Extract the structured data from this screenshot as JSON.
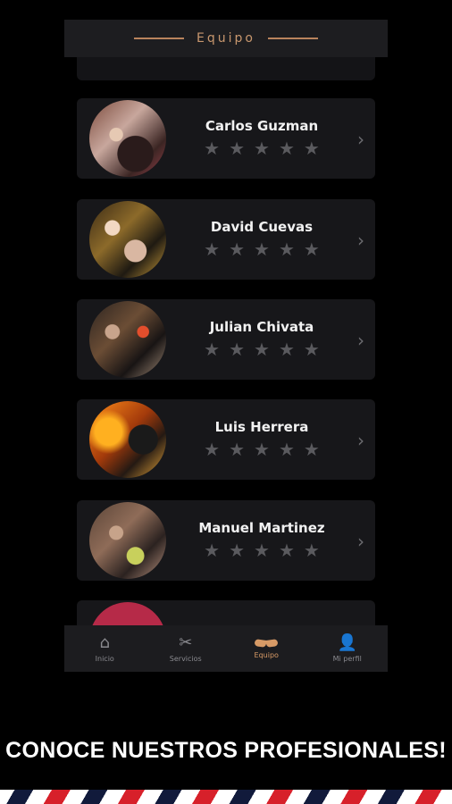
{
  "header": {
    "title": "Equipo"
  },
  "team": [
    {
      "name": "Carlos Guzman",
      "rating": 0,
      "avatar_icon": "barber-photo-1"
    },
    {
      "name": "David Cuevas",
      "rating": 0,
      "avatar_icon": "barber-photo-2"
    },
    {
      "name": "Julian Chivata",
      "rating": 0,
      "avatar_icon": "barber-photo-3"
    },
    {
      "name": "Luis Herrera",
      "rating": 0,
      "avatar_icon": "barber-photo-4"
    },
    {
      "name": "Manuel Martinez",
      "rating": 0,
      "avatar_icon": "barber-photo-5"
    }
  ],
  "nav": {
    "items": [
      {
        "label": "Inicio",
        "icon": "home-icon"
      },
      {
        "label": "Servicios",
        "icon": "scissors-icon"
      },
      {
        "label": "Equipo",
        "icon": "mustache-icon",
        "active": true
      },
      {
        "label": "Mi perfil",
        "icon": "user-icon"
      }
    ]
  },
  "promo": {
    "headline": "CONOCE NUESTROS PROFESIONALES!"
  },
  "colors": {
    "accent": "#d79a66",
    "card": "#17171a",
    "background": "#000000"
  }
}
